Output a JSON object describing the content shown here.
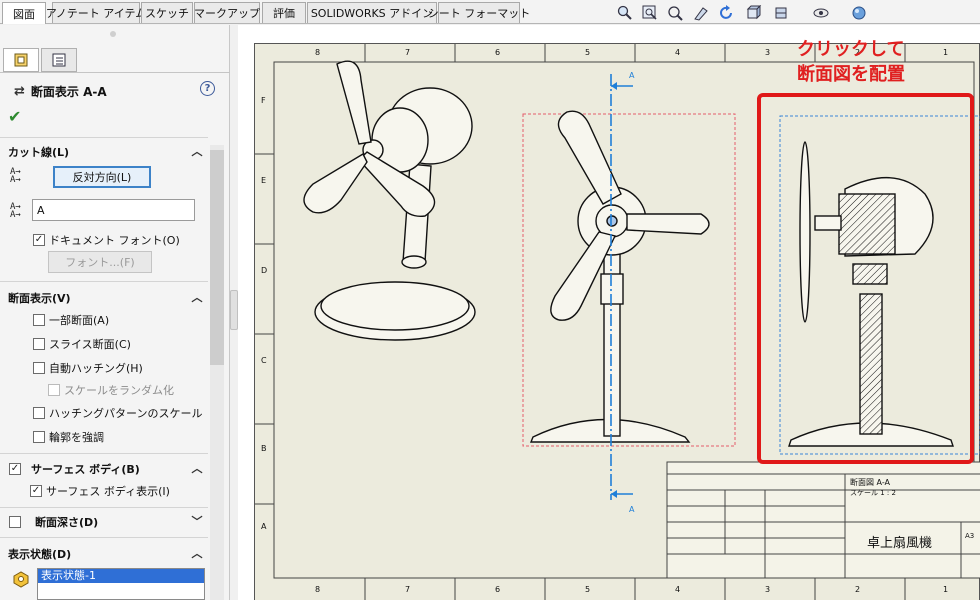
{
  "tabs": [
    {
      "label": "図面",
      "active": true
    },
    {
      "label": "アノテート アイテム"
    },
    {
      "label": "スケッチ"
    },
    {
      "label": "マークアップ"
    },
    {
      "label": "評価"
    },
    {
      "label": "SOLIDWORKS アドイン"
    },
    {
      "label": "シート フォーマット"
    }
  ],
  "toolbar_icons": [
    "zoom-to-fit-icon",
    "zoom-area-icon",
    "zoom-previous-icon",
    "section-view-icon",
    "rotate-icon",
    "view-orientation-icon",
    "display-style-icon",
    "hide-show-icon",
    "appearance-icon"
  ],
  "property_manager": {
    "title": "断面表示 A-A",
    "cut_line": {
      "header": "カット線(L)",
      "flip_button": "反対方向(L)",
      "label_value": "A",
      "doc_font": "ドキュメント フォント(O)",
      "font_button": "フォント...(F)"
    },
    "section_view": {
      "header": "断面表示(V)",
      "options": [
        {
          "label": "一部断面(A)",
          "checked": false
        },
        {
          "label": "スライス断面(C)",
          "checked": false
        },
        {
          "label": "自動ハッチング(H)",
          "checked": false
        },
        {
          "label": "スケールをランダム化",
          "checked": false,
          "disabled": true
        },
        {
          "label": "ハッチングパターンのスケール",
          "checked": false
        },
        {
          "label": "輪郭を強調",
          "checked": false
        }
      ]
    },
    "surface_bodies": {
      "header": "サーフェス ボディ(B)",
      "option": "サーフェス ボディ表示(I)"
    },
    "section_depth": {
      "header": "断面深さ(D)"
    },
    "display_state": {
      "header": "表示状態(D)",
      "item": "表示状態-1"
    }
  },
  "drawing": {
    "callout_line1": "クリックして",
    "callout_line2": "断面図を配置",
    "zone_numbers_top": [
      "8",
      "7",
      "6",
      "5",
      "4",
      "3",
      "2",
      "1"
    ],
    "zone_letters": [
      "F",
      "E",
      "D",
      "C",
      "B",
      "A"
    ],
    "section_label": "A",
    "title_block": {
      "view_name": "断面図 A-A",
      "scale": "スケール 1 : 2",
      "part_name": "卓上扇風機",
      "size": "A3"
    }
  },
  "colors": {
    "accent": "#2f6fd6",
    "callout": "#e02020",
    "sheet": "#ecebdd",
    "section_line": "#1f7fd8"
  }
}
